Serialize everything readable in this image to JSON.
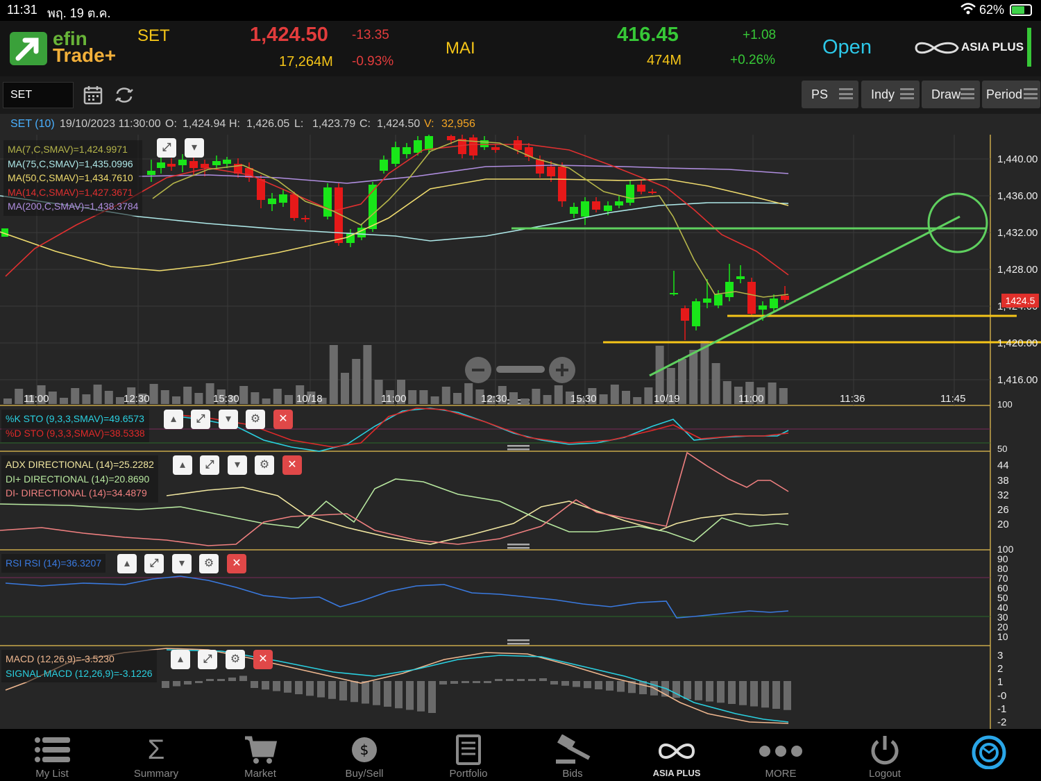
{
  "status_bar": {
    "time": "11:31",
    "date": "พฤ. 19 ต.ค.",
    "wifi": "wifi-icon",
    "battery_pct": "62%",
    "battery_level": 0.62
  },
  "header": {
    "logo_top": "efin",
    "logo_bottom": "Trade+",
    "set": {
      "label": "SET",
      "value": "1,424.50",
      "change": "-13.35",
      "volume": "17,264M",
      "pct": "-0.93%"
    },
    "mai": {
      "label": "MAI",
      "value": "416.45",
      "change": "+1.08",
      "volume": "474M",
      "pct": "+0.26%"
    },
    "market_status": "Open",
    "broker": "ASIA PLUS",
    "colors": {
      "up": "#37c837",
      "down": "#e23c3c",
      "label": "#f5c518",
      "open": "#2dc8e8"
    }
  },
  "toolbar": {
    "symbol": "SET",
    "buttons": [
      "PS",
      "Indy",
      "Draw",
      "Period"
    ],
    "icons": [
      "calendar-icon",
      "refresh-icon"
    ]
  },
  "info_bar": {
    "symbol": "SET (10)",
    "datetime": "19/10/2023 11:30:00",
    "o_label": "O:",
    "o": "1,424.94",
    "h_label": "H:",
    "h": "1,426.05",
    "l_label": "L:",
    "l": "1,423.79",
    "c_label": "C:",
    "c": "1,424.50",
    "v_label": "V:",
    "v": "32,956"
  },
  "price_panel": {
    "legend": [
      {
        "text": "MA(7,C,SMAV)=1,424.9971",
        "color": "#b5b54a"
      },
      {
        "text": "MA(75,C,SMAV)=1,435.0996",
        "color": "#aee8e8"
      },
      {
        "text": "MA(50,C,SMAV)=1,434.7610",
        "color": "#f0dc6e"
      },
      {
        "text": "MA(14,C,SMAV)=1,427.3671",
        "color": "#e03030"
      },
      {
        "text": "MA(200,C,SMAV)=1,438.3784",
        "color": "#b08ee0"
      }
    ],
    "y_ticks": [
      "1,440.00",
      "1,436.00",
      "1,432.00",
      "1,428.00",
      "1,424.00",
      "1,420.00",
      "1,416.00"
    ],
    "last_price": "1424.5",
    "x_ticks": [
      "11:00",
      "12:30",
      "15:30",
      "10/18",
      "11:00",
      "12:30",
      "15:30",
      "10/19",
      "11:00",
      "11:36",
      "11:45"
    ]
  },
  "sto_panel": {
    "legend": [
      {
        "text": "%K STO (9,3,3,SMAV)=49.6573",
        "color": "#2ad0e0"
      },
      {
        "text": "%D STO (9,3,3,SMAV)=38.5338",
        "color": "#e02a2a"
      }
    ],
    "y_ticks": [
      "100",
      "50"
    ]
  },
  "adx_panel": {
    "legend": [
      {
        "text": "ADX DIRECTIONAL (14)=25.2282",
        "color": "#f0e6a0"
      },
      {
        "text": "DI+ DIRECTIONAL (14)=20.8690",
        "color": "#b8e8a0"
      },
      {
        "text": "DI- DIRECTIONAL (14)=34.4879",
        "color": "#f08080"
      }
    ],
    "y_ticks": [
      "44",
      "38",
      "32",
      "26",
      "20"
    ]
  },
  "rsi_panel": {
    "legend": [
      {
        "text": "RSI RSI (14)=36.3207",
        "color": "#3a7ae0"
      }
    ],
    "y_ticks": [
      "100",
      "90",
      "80",
      "70",
      "60",
      "50",
      "40",
      "30",
      "20",
      "10"
    ]
  },
  "macd_panel": {
    "legend": [
      {
        "text": "MACD (12,26,9)=-3.5230",
        "color": "#f0b890"
      },
      {
        "text": "SIGNAL MACD (12,26,9)=-3.1226",
        "color": "#2ad0e0"
      }
    ],
    "y_ticks": [
      "3",
      "2",
      "1",
      "-0",
      "-1",
      "-2"
    ]
  },
  "bottom_nav": [
    {
      "label": "My List",
      "icon": "list-icon"
    },
    {
      "label": "Summary",
      "icon": "sigma-icon"
    },
    {
      "label": "Market",
      "icon": "cart-icon"
    },
    {
      "label": "Buy/Sell",
      "icon": "buysell-icon"
    },
    {
      "label": "Portfolio",
      "icon": "portfolio-icon"
    },
    {
      "label": "Bids",
      "icon": "gavel-icon"
    },
    {
      "label": "ASIA PLUS",
      "icon": "asiaplus-icon"
    },
    {
      "label": "MORE",
      "icon": "more-icon"
    },
    {
      "label": "Logout",
      "icon": "power-icon"
    },
    {
      "label": "",
      "icon": "refresh-circle-icon"
    }
  ]
}
